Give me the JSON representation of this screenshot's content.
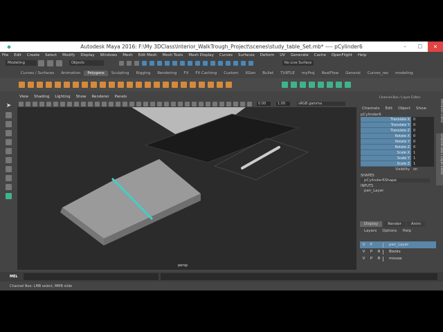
{
  "window": {
    "title": "Autodesk Maya 2016: F:\\My 3DClass\\Interior_WalkTrough_Project\\scenes\\study_table_Set.mb*  ----  pCylinder6",
    "minimize": "–",
    "maximize": "☐",
    "close": "✕"
  },
  "menu": [
    "File",
    "Edit",
    "Create",
    "Select",
    "Modify",
    "Display",
    "Windows",
    "Mesh",
    "Edit Mesh",
    "Mesh Tools",
    "Mesh Display",
    "Curves",
    "Surfaces",
    "Deform",
    "UV",
    "Generate",
    "Cache",
    "OpenFlight",
    "Help"
  ],
  "status": {
    "mode": "Modeling",
    "objects": "Objects",
    "live_surface": "No Live Surface"
  },
  "shelf_tabs": [
    "Curves / Surfaces",
    "Animation",
    "Polygons",
    "Sculpting",
    "Rigging",
    "Rendering",
    "FX",
    "FX Caching",
    "Custom",
    "XGen",
    "Bullet",
    "TURTLE",
    "myProj",
    "RealFlow",
    "General",
    "Curves_res",
    "modeling"
  ],
  "shelf_active": "Polygons",
  "viewport": {
    "menu": [
      "View",
      "Shading",
      "Lighting",
      "Show",
      "Renderer",
      "Panels"
    ],
    "exposure": "0.00",
    "gamma": "1.00",
    "color_space": "sRGB gamma",
    "camera": "persp"
  },
  "channel_box": {
    "header": "Channel Box / Layer Editor",
    "menu": [
      "Channels",
      "Edit",
      "Object",
      "Show"
    ],
    "object": "pCylinder6",
    "attributes": [
      {
        "name": "Translate X",
        "value": "0"
      },
      {
        "name": "Translate Y",
        "value": "0"
      },
      {
        "name": "Translate Z",
        "value": "0"
      },
      {
        "name": "Rotate X",
        "value": "0"
      },
      {
        "name": "Rotate Y",
        "value": "0"
      },
      {
        "name": "Rotate Z",
        "value": "0"
      },
      {
        "name": "Scale X",
        "value": "1"
      },
      {
        "name": "Scale Y",
        "value": "1"
      },
      {
        "name": "Scale Z",
        "value": "1"
      }
    ],
    "visibility": {
      "name": "Visibility",
      "value": "on"
    },
    "shapes_label": "SHAPES",
    "shape": "pCylinder6Shape",
    "inputs_label": "INPUTS",
    "input": "pen_Layer",
    "side_tabs": [
      "Attribute Editor",
      "Channel Box / Layer Editor"
    ]
  },
  "layer_editor": {
    "tabs": [
      "Display",
      "Render",
      "Anim"
    ],
    "menu": [
      "Layers",
      "Options",
      "Help"
    ],
    "layers": [
      {
        "v": "V",
        "p": "P",
        "r": "",
        "name": "pen_Layer",
        "selected": true
      },
      {
        "v": "V",
        "p": "P",
        "r": "R",
        "name": "Books",
        "selected": false
      },
      {
        "v": "V",
        "p": "P",
        "r": "R",
        "name": "mouse",
        "selected": false
      }
    ]
  },
  "command_line": {
    "label": "MEL"
  },
  "help_line": "Channel Box: LMB select, MMB slide"
}
